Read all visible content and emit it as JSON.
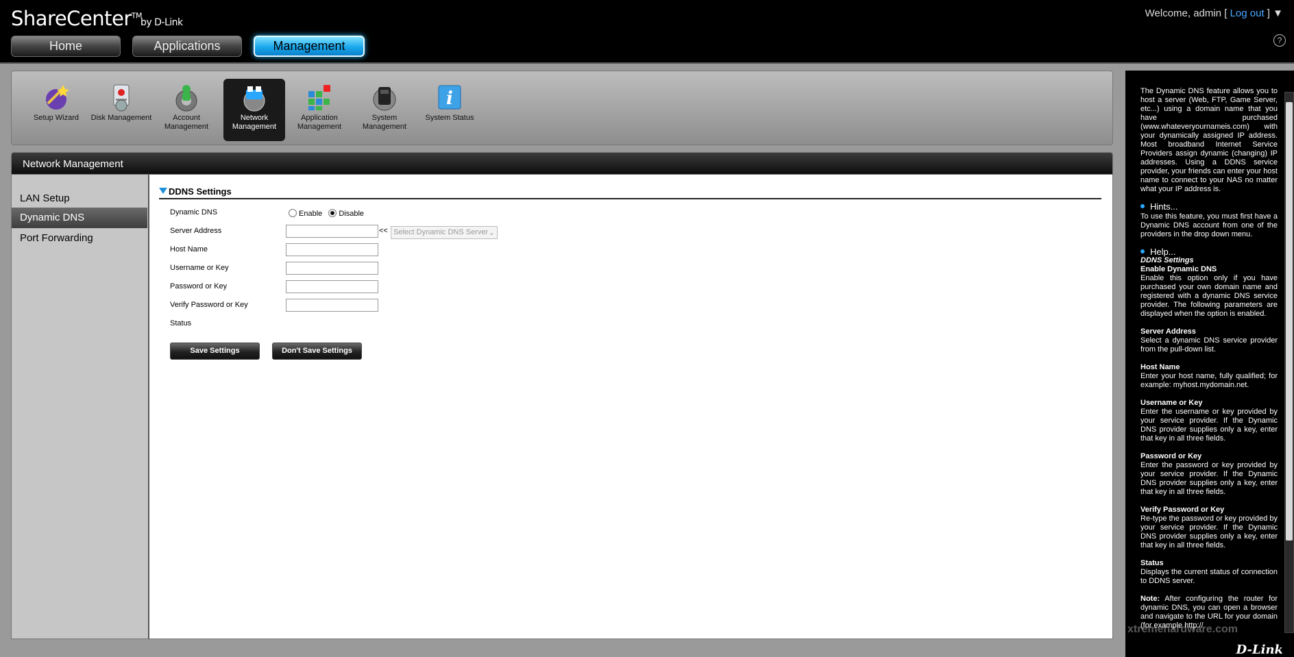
{
  "header": {
    "logo": "ShareCenter",
    "logo_tm": "TM",
    "logo_by": "by D-Link",
    "welcome_prefix": "Welcome, admin [",
    "logout": "Log out",
    "welcome_suffix": "]",
    "help_icon": "?"
  },
  "top_tabs": [
    {
      "label": "Home",
      "active": false
    },
    {
      "label": "Applications",
      "active": false
    },
    {
      "label": "Management",
      "active": true
    }
  ],
  "icon_bar": [
    {
      "label": "Setup Wizard",
      "icon": "wizard-icon"
    },
    {
      "label": "Disk Management",
      "icon": "disk-icon"
    },
    {
      "label": "Account Management",
      "icon": "account-icon"
    },
    {
      "label": "Network Management",
      "icon": "network-icon",
      "active": true
    },
    {
      "label": "Application Management",
      "icon": "application-icon"
    },
    {
      "label": "System Management",
      "icon": "system-icon"
    },
    {
      "label": "System Status",
      "icon": "info-icon"
    }
  ],
  "panel_title": "Network Management",
  "left_nav": [
    {
      "label": "LAN Setup",
      "active": false
    },
    {
      "label": "Dynamic DNS",
      "active": true
    },
    {
      "label": "Port Forwarding",
      "active": false
    }
  ],
  "ddns": {
    "section_title": "DDNS Settings",
    "labels": {
      "dynamic_dns": "Dynamic DNS",
      "server_address": "Server Address",
      "host_name": "Host Name",
      "username": "Username or Key",
      "password": "Password or Key",
      "verify_password": "Verify Password or Key",
      "status": "Status"
    },
    "enable_label": "Enable",
    "disable_label": "Disable",
    "selected": "Disable",
    "server_arrow": "<<",
    "server_select": "Select Dynamic DNS Server",
    "server_address_value": "",
    "host_name_value": "",
    "username_value": "",
    "password_value": "",
    "verify_password_value": "",
    "status_value": "",
    "save_button": "Save Settings",
    "dont_save_button": "Don't Save Settings"
  },
  "help_panel": {
    "intro": "The Dynamic DNS feature allows you to host a server (Web, FTP, Game Server, etc...) using a domain name that you have purchased (www.whateveryournameis.com) with your dynamically assigned IP address. Most broadband Internet Service Providers assign dynamic (changing) IP addresses. Using a DDNS service provider, your friends can enter your host name to connect to your NAS no matter what your IP address is.",
    "hints_title": "Hints...",
    "hints_text": "To use this feature, you must first have a Dynamic DNS account from one of the providers in the drop down menu.",
    "help_title": "Help...",
    "help_subtitle": "DDNS Settings",
    "items": [
      {
        "title": "Enable Dynamic DNS",
        "text": "Enable this option only if you have purchased your own domain name and registered with a dynamic DNS service provider. The following parameters are displayed when the option is enabled."
      },
      {
        "title": "Server Address",
        "text": "Select a dynamic DNS service provider from the pull-down list."
      },
      {
        "title": "Host Name",
        "text": "Enter your host name, fully qualified; for example: myhost.mydomain.net."
      },
      {
        "title": "Username or Key",
        "text": "Enter the username or key provided by your service provider. If the Dynamic DNS provider supplies only a key, enter that key in all three fields."
      },
      {
        "title": "Password or Key",
        "text": "Enter the password or key provided by your service provider. If the Dynamic DNS provider supplies only a key, enter that key in all three fields."
      },
      {
        "title": "Verify Password or Key",
        "text": "Re-type the password or key provided by your service provider. If the Dynamic DNS provider supplies only a key, enter that key in all three fields."
      },
      {
        "title": "Status",
        "text": "Displays the current status of connection to DDNS server."
      }
    ],
    "note_label": "Note:",
    "note_text": "After configuring the router for dynamic DNS, you can open a browser and navigate to the URL for your domain (for example http://",
    "brand": "D-Link"
  },
  "watermark": "xtremehardware.com",
  "colors": {
    "accent": "#1e90d8",
    "active_tab": "#19a8ec",
    "link": "#4aa8ff"
  }
}
